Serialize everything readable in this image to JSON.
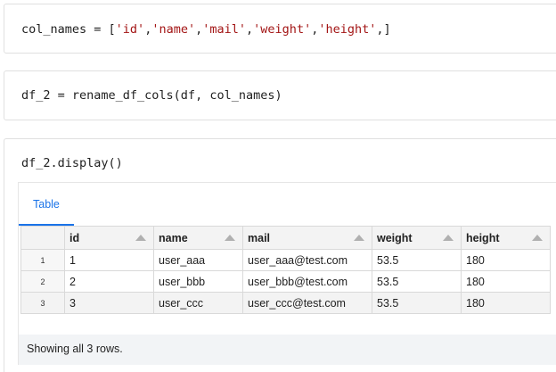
{
  "cells": [
    {
      "code_parts": [
        {
          "t": "col_names = [",
          "c": ""
        },
        {
          "t": "'id'",
          "c": "str"
        },
        {
          "t": ",",
          "c": ""
        },
        {
          "t": "'name'",
          "c": "str"
        },
        {
          "t": ",",
          "c": ""
        },
        {
          "t": "'mail'",
          "c": "str"
        },
        {
          "t": ",",
          "c": ""
        },
        {
          "t": "'weight'",
          "c": "str"
        },
        {
          "t": ",",
          "c": ""
        },
        {
          "t": "'height'",
          "c": "str"
        },
        {
          "t": ",]",
          "c": ""
        }
      ]
    },
    {
      "code": "df_2 = rename_df_cols(df, col_names)"
    },
    {
      "code": "df_2.display()"
    }
  ],
  "output": {
    "tab_label": "Table",
    "columns": [
      "id",
      "name",
      "mail",
      "weight",
      "height"
    ],
    "rows": [
      {
        "idx": "1",
        "cells": [
          "1",
          "user_aaa",
          "user_aaa@test.com",
          "53.5",
          "180"
        ]
      },
      {
        "idx": "2",
        "cells": [
          "2",
          "user_bbb",
          "user_bbb@test.com",
          "53.5",
          "180"
        ]
      },
      {
        "idx": "3",
        "cells": [
          "3",
          "user_ccc",
          "user_ccc@test.com",
          "53.5",
          "180"
        ]
      }
    ],
    "footer": "Showing all 3 rows."
  },
  "colors": {
    "string": "#a31515",
    "accent": "#1a73e8"
  }
}
